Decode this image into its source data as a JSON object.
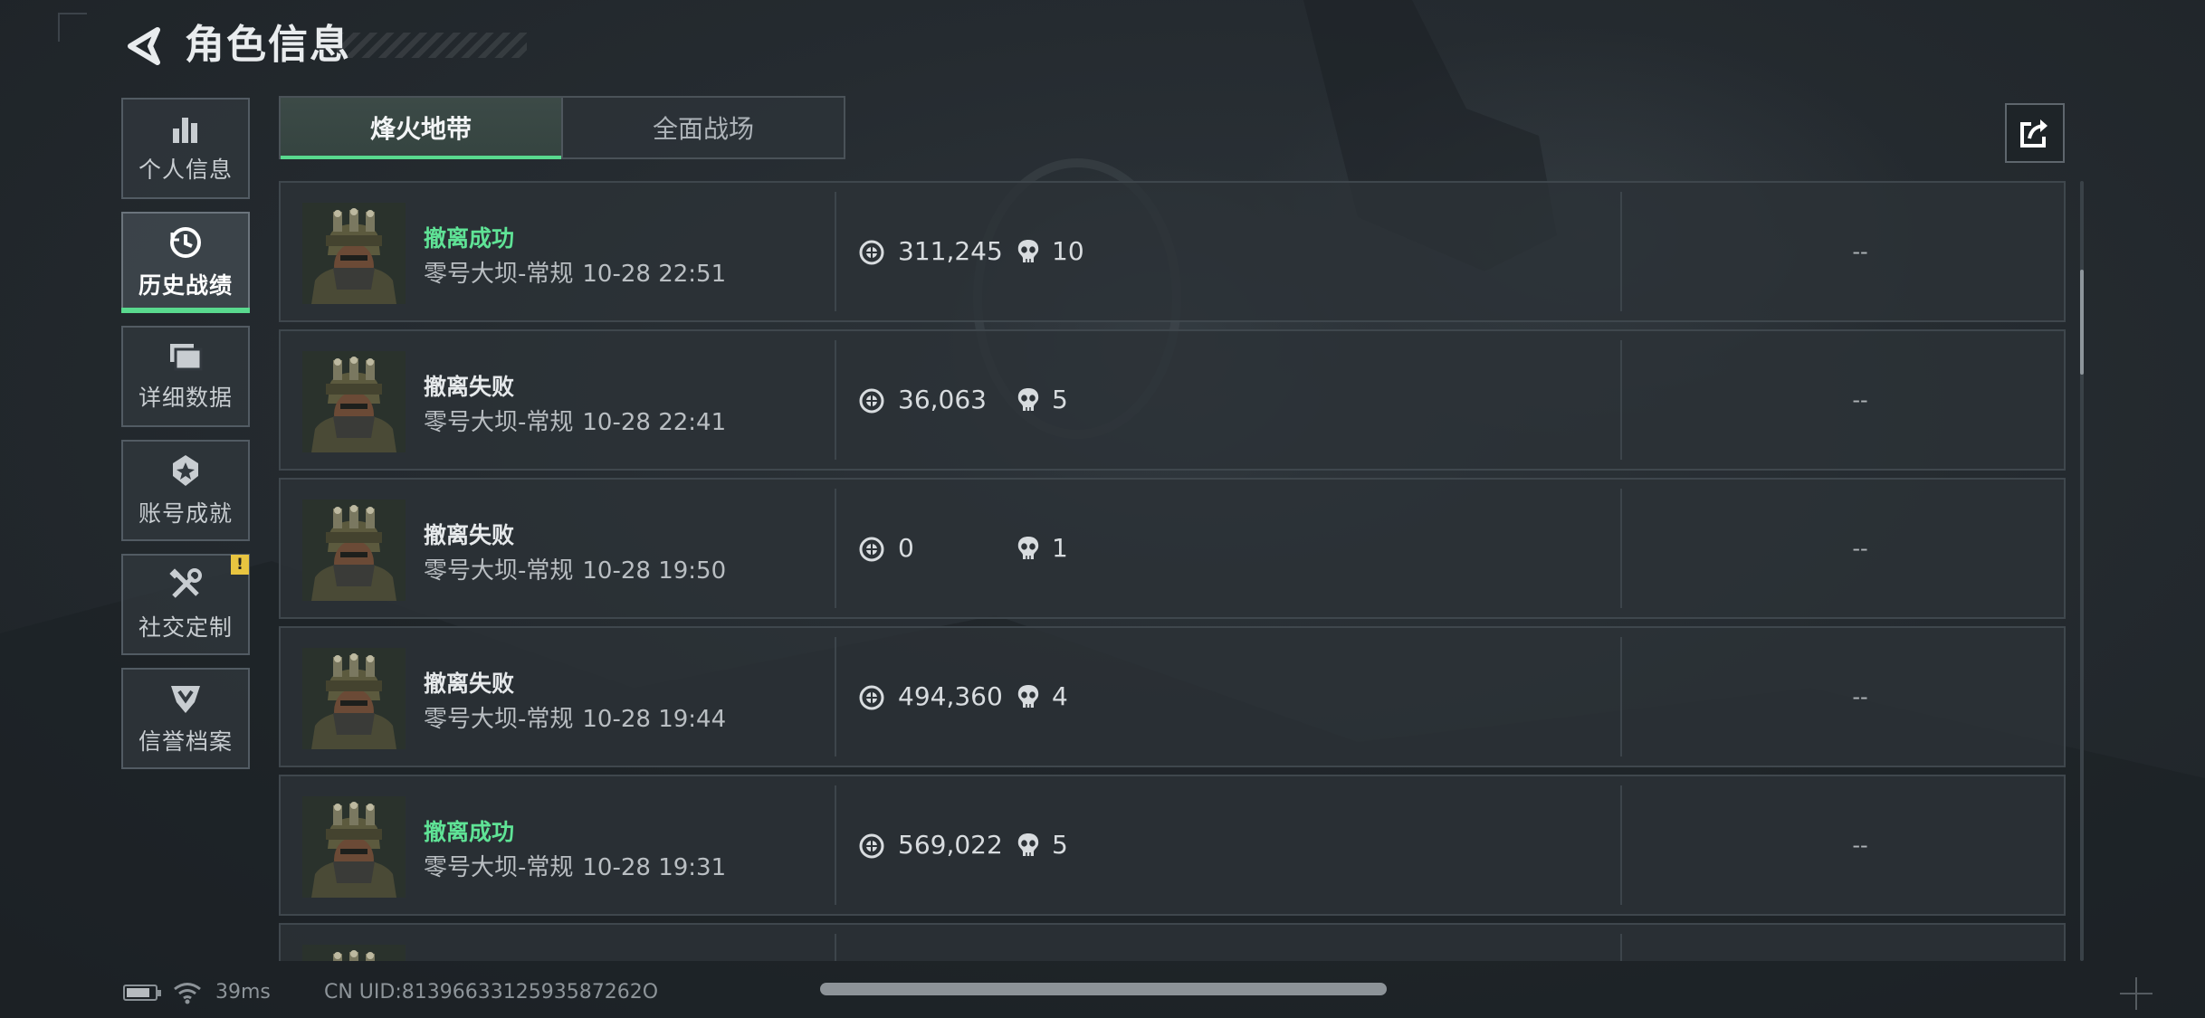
{
  "header": {
    "title": "角色信息"
  },
  "sidebar": {
    "items": [
      {
        "label": "个人信息",
        "icon": "bar-chart-icon",
        "active": false
      },
      {
        "label": "历史战绩",
        "icon": "clock-icon",
        "active": true
      },
      {
        "label": "详细数据",
        "icon": "folders-icon",
        "active": false
      },
      {
        "label": "账号成就",
        "icon": "medal-icon",
        "active": false
      },
      {
        "label": "社交定制",
        "icon": "tools-icon",
        "active": false,
        "badge": "!"
      },
      {
        "label": "信誉档案",
        "icon": "credit-shield-icon",
        "active": false
      }
    ]
  },
  "tabs": [
    {
      "label": "烽火地带",
      "active": true
    },
    {
      "label": "全面战场",
      "active": false
    }
  ],
  "share": {
    "icon": "share-icon"
  },
  "colors": {
    "accent_green": "#59d98e",
    "success_text": "#5fe396",
    "badge_yellow": "#e8c440"
  },
  "records": [
    {
      "status": "撤离成功",
      "success": true,
      "map": "零号大坝-常规",
      "time": "10-28 22:51",
      "value": "311,245",
      "kills": "10",
      "extra": "--"
    },
    {
      "status": "撤离失败",
      "success": false,
      "map": "零号大坝-常规",
      "time": "10-28 22:41",
      "value": "36,063",
      "kills": "5",
      "extra": "--"
    },
    {
      "status": "撤离失败",
      "success": false,
      "map": "零号大坝-常规",
      "time": "10-28 19:50",
      "value": "0",
      "kills": "1",
      "extra": "--"
    },
    {
      "status": "撤离失败",
      "success": false,
      "map": "零号大坝-常规",
      "time": "10-28 19:44",
      "value": "494,360",
      "kills": "4",
      "extra": "--"
    },
    {
      "status": "撤离成功",
      "success": true,
      "map": "零号大坝-常规",
      "time": "10-28 19:31",
      "value": "569,022",
      "kills": "5",
      "extra": "--"
    }
  ],
  "footer": {
    "ping": "39ms",
    "uid": "CN UID:8139663312593587262O"
  }
}
